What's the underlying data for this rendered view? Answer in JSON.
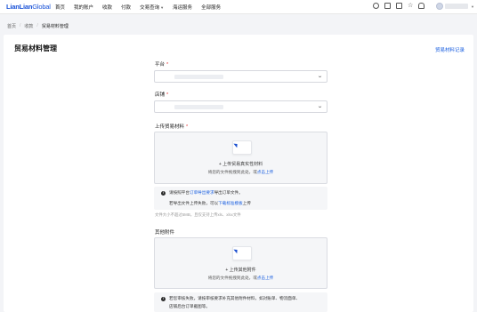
{
  "brand": {
    "name_bold": "LianLian",
    "name_light": "Global"
  },
  "nav": [
    "首页",
    "我的账户",
    "收款",
    "付款",
    "交易查询",
    "海运服务",
    "全部服务"
  ],
  "breadcrumb": {
    "home": "首页",
    "level2": "收款",
    "current": "贸易材料管理"
  },
  "page": {
    "title": "贸易材料管理",
    "record_link": "贸易材料记录"
  },
  "form": {
    "platform_label": "平台",
    "store_label": "店铺",
    "upload_label": "上传贸易材料",
    "trade_upload": {
      "title": "+ 上传贸易真实性材料",
      "hint_prefix": "将您的文件拖拽到此处，或",
      "hint_link": "点击上传"
    },
    "trade_notice": {
      "line1_prefix": "请按照平台",
      "line1_link": "订单导出要求",
      "line1_suffix": "导出订单文件。",
      "line2_prefix": "若导出文件上传失败，可以",
      "line2_link": "下载标准模板",
      "line2_suffix": "上传"
    },
    "size_hint": "文件大小不超过5MB，且仅支持上传xls、xlsx文件",
    "other_label": "其他附件",
    "other_upload": {
      "title": "+ 上传其他附件",
      "hint_prefix": "将您的文件拖拽到此处，或",
      "hint_link": "点击上传"
    },
    "other_notice": {
      "line1": "若您审核失败，请按审核要求补充其他附件材料，如对账单、物流面单、",
      "line2": "店铺后台订单截图等。"
    }
  }
}
